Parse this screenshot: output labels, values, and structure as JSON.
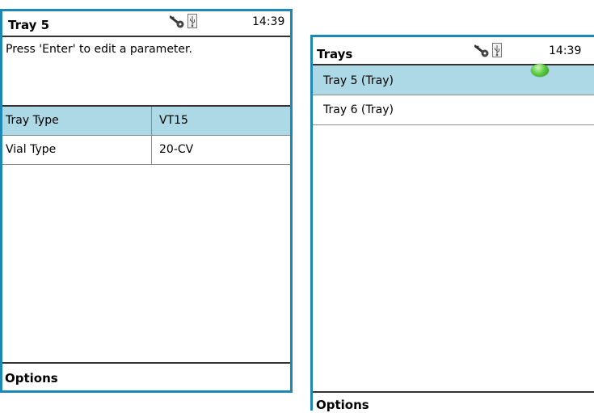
{
  "left_screen": {
    "title": "Tray 5",
    "time": "14:39",
    "message": "Press 'Enter' to edit a parameter.",
    "rows": [
      {
        "label": "Tray Type",
        "value": "VT15",
        "selected": true
      },
      {
        "label": "Vial Type",
        "value": "20-CV",
        "selected": false
      }
    ],
    "footer": "Options",
    "icons": [
      "key-icon",
      "usb-icon"
    ]
  },
  "right_screen": {
    "title": "Trays",
    "time": "14:39",
    "items": [
      {
        "label": "Tray 5 (Tray)",
        "selected": true
      },
      {
        "label": "Tray 6 (Tray)",
        "selected": false
      }
    ],
    "footer": "Options",
    "icons": [
      "key-icon",
      "usb-icon",
      "green-status-icon"
    ]
  },
  "colors": {
    "frame": "#1d87b6",
    "selection": "#add8e6",
    "status_green": "#55c93c"
  }
}
